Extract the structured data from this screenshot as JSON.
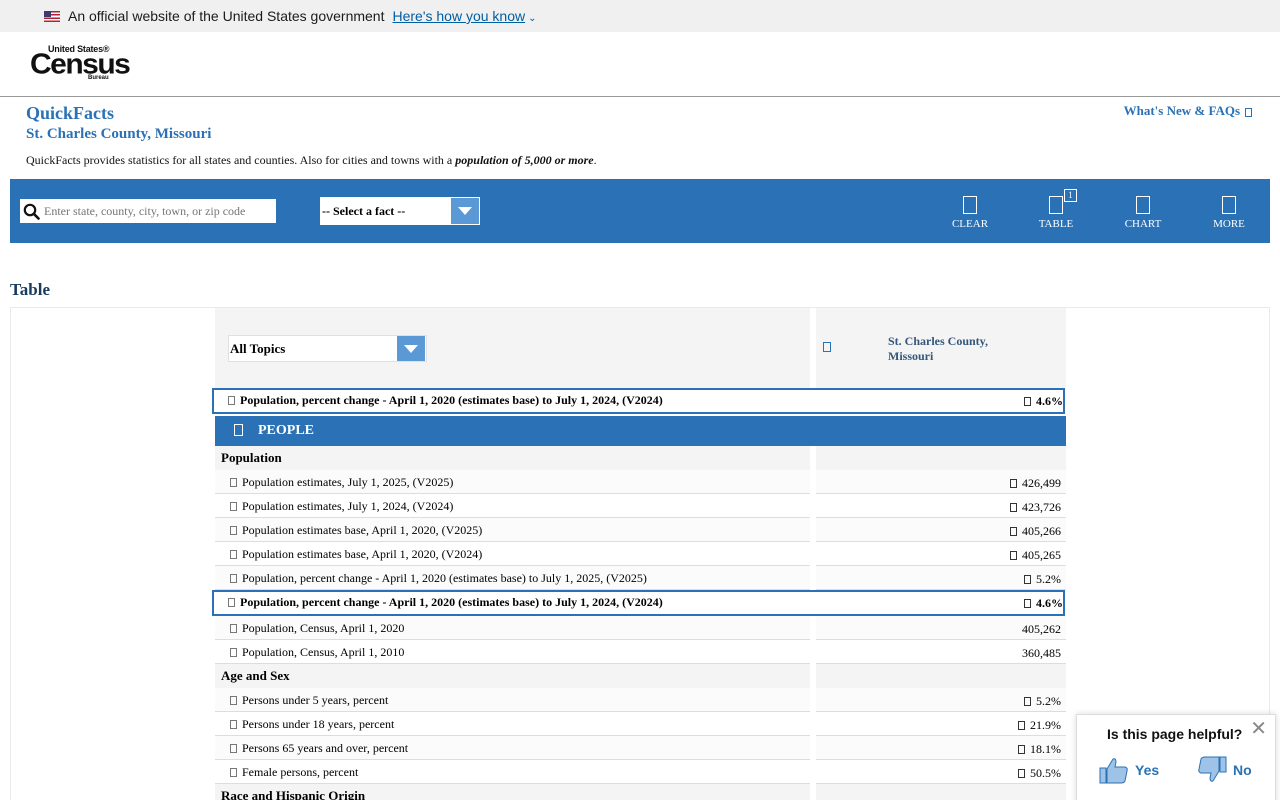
{
  "gov_banner": {
    "text": "An official website of the United States government",
    "link": "Here's how you know"
  },
  "logo": {
    "top": "United States®",
    "main": "Census",
    "bottom": "Bureau"
  },
  "header": {
    "title": "QuickFacts",
    "subtitle": "St. Charles County, Missouri",
    "desc_prefix": "QuickFacts provides statistics for all states and counties. Also for cities and towns with a",
    "desc_emph": "population of 5,000 or more",
    "desc_suffix": ".",
    "whats_new": "What's New & FAQs"
  },
  "toolbar": {
    "search_placeholder": "Enter state, county, city, town, or zip code",
    "select_fact": "-- Select a fact --",
    "clear": "CLEAR",
    "table": "TABLE",
    "table_badge": "1",
    "chart": "CHART",
    "more": "MORE"
  },
  "table": {
    "heading": "Table",
    "topics": "All Topics",
    "column_title_1": "St. Charles County,",
    "column_title_2": "Missouri",
    "highlight_top": {
      "label": "Population, percent change - April 1, 2020 (estimates base) to July 1, 2024, (V2024)",
      "value": "4.6%"
    },
    "section": "PEOPLE",
    "categories": {
      "population": "Population",
      "age_sex": "Age and Sex",
      "race": "Race and Hispanic Origin"
    },
    "rows": [
      {
        "label": "Population estimates, July 1, 2025, (V2025)",
        "value": "426,499"
      },
      {
        "label": "Population estimates, July 1, 2024, (V2024)",
        "value": "423,726"
      },
      {
        "label": "Population estimates base, April 1, 2020, (V2025)",
        "value": "405,266"
      },
      {
        "label": "Population estimates base, April 1, 2020, (V2024)",
        "value": "405,265"
      },
      {
        "label": "Population, percent change - April 1, 2020 (estimates base) to July 1, 2025, (V2025)",
        "value": "5.2%"
      },
      {
        "label": "Population, percent change - April 1, 2020 (estimates base) to July 1, 2024, (V2024)",
        "value": "4.6%"
      },
      {
        "label": "Population, Census, April 1, 2020",
        "value": "405,262"
      },
      {
        "label": "Population, Census, April 1, 2010",
        "value": "360,485"
      }
    ],
    "age_rows": [
      {
        "label": "Persons under 5 years, percent",
        "value": "5.2%"
      },
      {
        "label": "Persons under 18 years, percent",
        "value": "21.9%"
      },
      {
        "label": "Persons 65 years and over, percent",
        "value": "18.1%"
      },
      {
        "label": "Female persons, percent",
        "value": "50.5%"
      }
    ]
  },
  "feedback": {
    "question": "Is this page helpful?",
    "yes": "Yes",
    "no": "No"
  },
  "colors": {
    "brand_blue": "#2a72b5",
    "gov_link": "#005ea2"
  }
}
